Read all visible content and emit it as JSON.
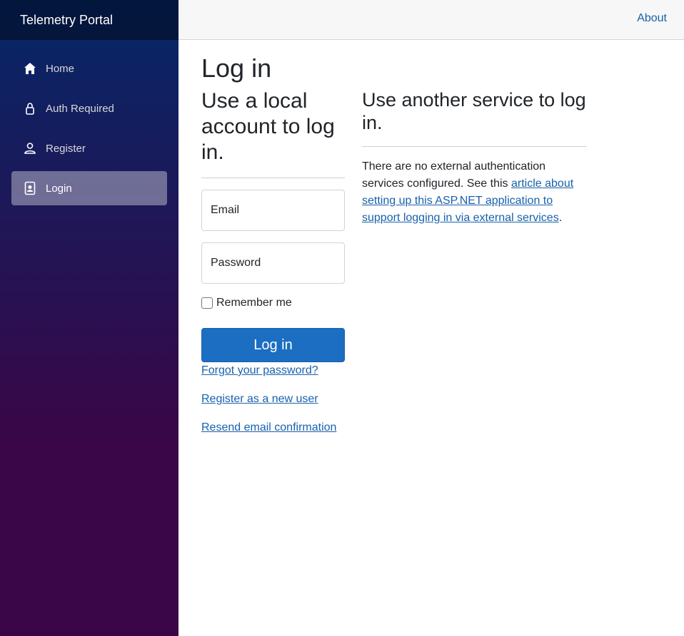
{
  "brand": "Telemetry Portal",
  "nav": {
    "home": "Home",
    "auth_required": "Auth Required",
    "register": "Register",
    "login": "Login"
  },
  "topbar": {
    "about": "About"
  },
  "page": {
    "title": "Log in"
  },
  "local": {
    "heading": "Use a local account to log in.",
    "email_placeholder": "Email",
    "password_placeholder": "Password",
    "remember_label": "Remember me",
    "submit_label": "Log in",
    "forgot_link": "Forgot your password?",
    "register_link": "Register as a new user",
    "resend_link": "Resend email confirmation"
  },
  "external": {
    "heading": "Use another service to log in.",
    "text_before": "There are no external authentication services configured. See this ",
    "link_text": "article about setting up this ASP.NET application to support logging in via external services",
    "text_after": "."
  },
  "colors": {
    "accent": "#1b6ec2",
    "link": "#1861ac",
    "sidebar_top": "#052767",
    "sidebar_bottom": "#3a0647"
  },
  "icons": {
    "home": "home-icon",
    "auth_required": "lock-icon",
    "register": "person-icon",
    "login": "person-badge-icon"
  }
}
